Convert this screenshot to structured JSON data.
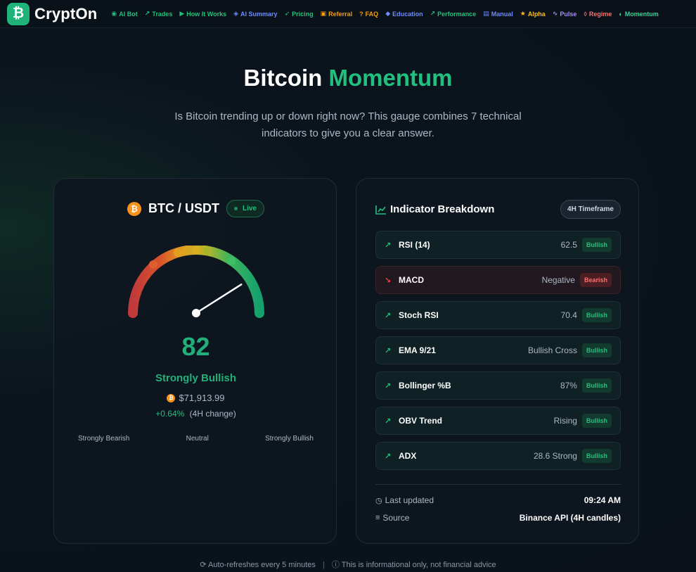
{
  "brand": {
    "icon": "bitcoin-icon",
    "name": "CryptOn"
  },
  "nav": [
    {
      "label": "AI Bot",
      "icon": "robot-icon",
      "color": "#22c07f"
    },
    {
      "label": "Trades",
      "icon": "chart-line-icon",
      "color": "#22c07f"
    },
    {
      "label": "How It Works",
      "icon": "play-circle-icon",
      "color": "#22c07f"
    },
    {
      "label": "AI Summary",
      "icon": "brain-icon",
      "color": "#6b8cff"
    },
    {
      "label": "Pricing",
      "icon": "rocket-icon",
      "color": "#22c07f"
    },
    {
      "label": "Referral",
      "icon": "gift-icon",
      "color": "#f59e0b"
    },
    {
      "label": "FAQ",
      "icon": "question-icon",
      "color": "#f59e0b"
    },
    {
      "label": "Education",
      "icon": "graduation-cap-icon",
      "color": "#6b8cff"
    },
    {
      "label": "Performance",
      "icon": "chart-line-icon",
      "color": "#22c07f"
    },
    {
      "label": "Manual",
      "icon": "book-icon",
      "color": "#6b8cff"
    },
    {
      "label": "Alpha",
      "icon": "star-icon",
      "color": "#fbbf24"
    },
    {
      "label": "Pulse",
      "icon": "wave-icon",
      "color": "#a78bfa"
    },
    {
      "label": "Regime",
      "icon": "shield-icon",
      "color": "#f87171"
    },
    {
      "label": "Momentum",
      "icon": "gauge-icon",
      "color": "#34d399"
    }
  ],
  "hero": {
    "title_main": "Bitcoin",
    "title_accent": "Momentum",
    "subtitle": "Is Bitcoin trending up or down right now? This gauge combines 7 technical indicators to give you a clear answer."
  },
  "gauge_card": {
    "pair": "BTC / USDT",
    "live_label": "Live",
    "score": "82",
    "score_value": 82,
    "verdict": "Strongly Bullish",
    "price": "$71,913.99",
    "change": "+0.64%",
    "change_note": "(4H change)",
    "scale": [
      "Strongly Bearish",
      "Neutral",
      "Strongly Bullish"
    ]
  },
  "breakdown": {
    "title": "Indicator Breakdown",
    "timeframe": "4H Timeframe",
    "indicators": [
      {
        "name": "RSI (14)",
        "value": "62.5",
        "signal": "Bullish",
        "trend": "up"
      },
      {
        "name": "MACD",
        "value": "Negative",
        "signal": "Bearish",
        "trend": "down"
      },
      {
        "name": "Stoch RSI",
        "value": "70.4",
        "signal": "Bullish",
        "trend": "up"
      },
      {
        "name": "EMA 9/21",
        "value": "Bullish Cross",
        "signal": "Bullish",
        "trend": "up"
      },
      {
        "name": "Bollinger %B",
        "value": "87%",
        "signal": "Bullish",
        "trend": "up"
      },
      {
        "name": "OBV Trend",
        "value": "Rising",
        "signal": "Bullish",
        "trend": "up"
      },
      {
        "name": "ADX",
        "value": "28.6 Strong",
        "signal": "Bullish",
        "trend": "up"
      }
    ],
    "last_updated_label": "Last updated",
    "last_updated_value": "09:24 AM",
    "source_label": "Source",
    "source_value": "Binance API (4H candles)"
  },
  "footer": {
    "refresh": "Auto-refreshes every 5 minutes",
    "disclaimer": "This is informational only, not financial advice"
  },
  "colors": {
    "accent": "#22c07f",
    "bullish": "#22c07f",
    "bearish": "#ef4444",
    "btc": "#f7931a"
  }
}
